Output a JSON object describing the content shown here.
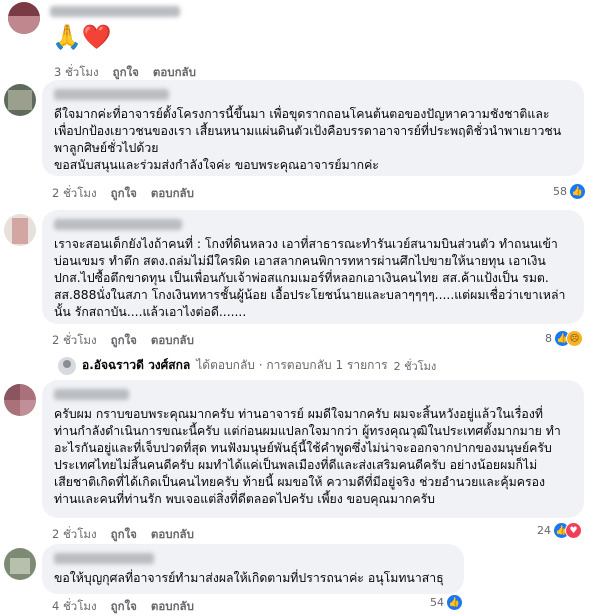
{
  "comments": [
    {
      "text": "🙏❤️",
      "time": "3 ชั่วโมง",
      "like": "ถูกใจ",
      "reply": "ตอบกลับ"
    },
    {
      "text": "ดีใจมากค่ะที่อาจารย์ตั้งโครงการนี้ขึ้นมา เพื่อขุดรากถอนโคนต้นตอของปัญหาความชังชาติและ\nเพื่อปกป้องเยาวชนของเรา เสี้ยนหนามแผ่นดินตัวเป้งคือบรรดาอาจารย์ที่ประพฤติชั่วนำพาเยาวชน\nพาลูกศิษย์ชั่วไปด้วย\nขอสนับสนุนและร่วมส่งกำลังใจค่ะ ขอบพระคุณอาจารย์มากค่ะ",
      "time": "2 ชั่วโมง",
      "like": "ถูกใจ",
      "reply": "ตอบกลับ",
      "reaction_count": "58"
    },
    {
      "text": "เราจะสอนเด็กยังไงถ้าคนที่ : โกงที่ดินหลวง เอาที่สาธารณะทำรันเวย์สนามบินส่วนตัว ทำถนนเข้า\nบ่อนเขมร ทำตึก สตง.ถล่มไม่มีใครผิด เอาสลากคนพิการทหารผ่านศึกไปขายให้นายทุน เอาเงิน\nปกส.ไปซื้อตึกขาดทุน เป็นเพื่อนกับเจ้าพ่อสแกมเมอร์ที่หลอกเอาเงินคนไทย สส.ค้าแป้งเป็น รมต.\nสส.888นั่งในสภา โกงเงินทหารชั้นผู้น้อย เอื้อประโยชน์นายและบลาๆๆๆๆ.....แต่ผมเชื่อว่าเขาเหล่า\nนั้น รักสถาบัน....แล้วเอาไงต่อดี.......",
      "time": "2 ชั่วโมง",
      "like": "ถูกใจ",
      "reply": "ตอบกลับ",
      "reaction_count": "8"
    },
    {
      "text": "ครับผม กราบขอบพระคุณมากครับ ท่านอาจารย์ ผมดีใจมากครับ ผมจะสิ้นหวังอยู่แล้วในเรื่องที่\nท่านกำลังดำเนินการขณะนี้ครับ แต่ก่อนผมแปลกใจมากว่า ผู้ทรงคุณวุฒิในประเทศตั้งมากมาย ทำ\nอะไรกันอยู่และที่เจ็บปวดที่สุด ทนฟังมนุษย์พันธุ์นี้ใช้คำพูดซึ่งไม่น่าจะออกจากปากของมนุษย์ครับ\nประเทศไทยไม่สิ้นคนดีครับ ผมทำได้แค่เป็นพลเมืองที่ดีและส่งเสริมคนดีครับ อย่างน้อยผมก็ไม่\nเสียชาติเกิดที่ได้เกิดเป็นคนไทยครับ ท้ายนี้ ผมขอให้ ความดีที่มีอยู่จริง ช่วยอำนวยและคุ้มครอง\nท่านและคนที่ท่านรัก พบเจอแต่สิ่งที่ดีตลอดไปครับ เพี้ยง ขอบคุณมากครับ",
      "time": "2 ชั่วโมง",
      "like": "ถูกใจ",
      "reply": "ตอบกลับ",
      "reaction_count": "24"
    },
    {
      "text": "ขอให้บุญกุศลที่อาจารย์ทำมาส่งผลให้เกิดตามที่ปรารถนาค่ะ อนุโมทนาสาธุ",
      "time": "4 ชั่วโมง",
      "like": "ถูกใจ",
      "reply": "ตอบกลับ",
      "reaction_count": "54"
    }
  ],
  "reply_thread": {
    "author": "อ.อัจฉราวดี วงศ์สกล",
    "text": "ได้ตอบกลับ · การตอบกลับ 1 รายการ",
    "time": "2 ชั่วโมง"
  },
  "colors": {
    "bubble": "#f0f2f5",
    "secondary_text": "#65676b",
    "like_blue": "#1877f2",
    "heart_red": "#f33e58"
  },
  "icons": [
    "like-icon",
    "heart-icon",
    "sad-icon",
    "avatar"
  ]
}
